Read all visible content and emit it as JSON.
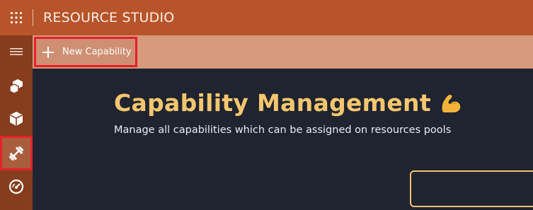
{
  "header": {
    "app_title": "RESOURCE STUDIO",
    "launcher_icon": "waffle-grid-icon"
  },
  "sidebar": {
    "items": [
      {
        "name": "menu",
        "icon": "hamburger-menu-icon",
        "active": false
      },
      {
        "name": "resources",
        "icon": "cubes-icon",
        "active": false
      },
      {
        "name": "resource-pools",
        "icon": "cube-icon",
        "active": false
      },
      {
        "name": "capabilities",
        "icon": "dumbbell-icon",
        "active": true
      },
      {
        "name": "dashboard",
        "icon": "gauge-icon",
        "active": false
      }
    ]
  },
  "toolbar": {
    "new_button_label": "New Capability",
    "new_button_icon": "plus-icon"
  },
  "main": {
    "title": "Capability Management",
    "title_emoji": "flexed-biceps-icon",
    "subtitle": "Manage all capabilities which can be assigned on resources pools"
  },
  "colors": {
    "header_bg": "#b7542a",
    "sidebar_bg": "#863d1d",
    "toolbar_bg": "#d79a7c",
    "main_bg": "#1f2430",
    "title_color": "#f6c66e",
    "highlight_border": "#e5202a"
  }
}
